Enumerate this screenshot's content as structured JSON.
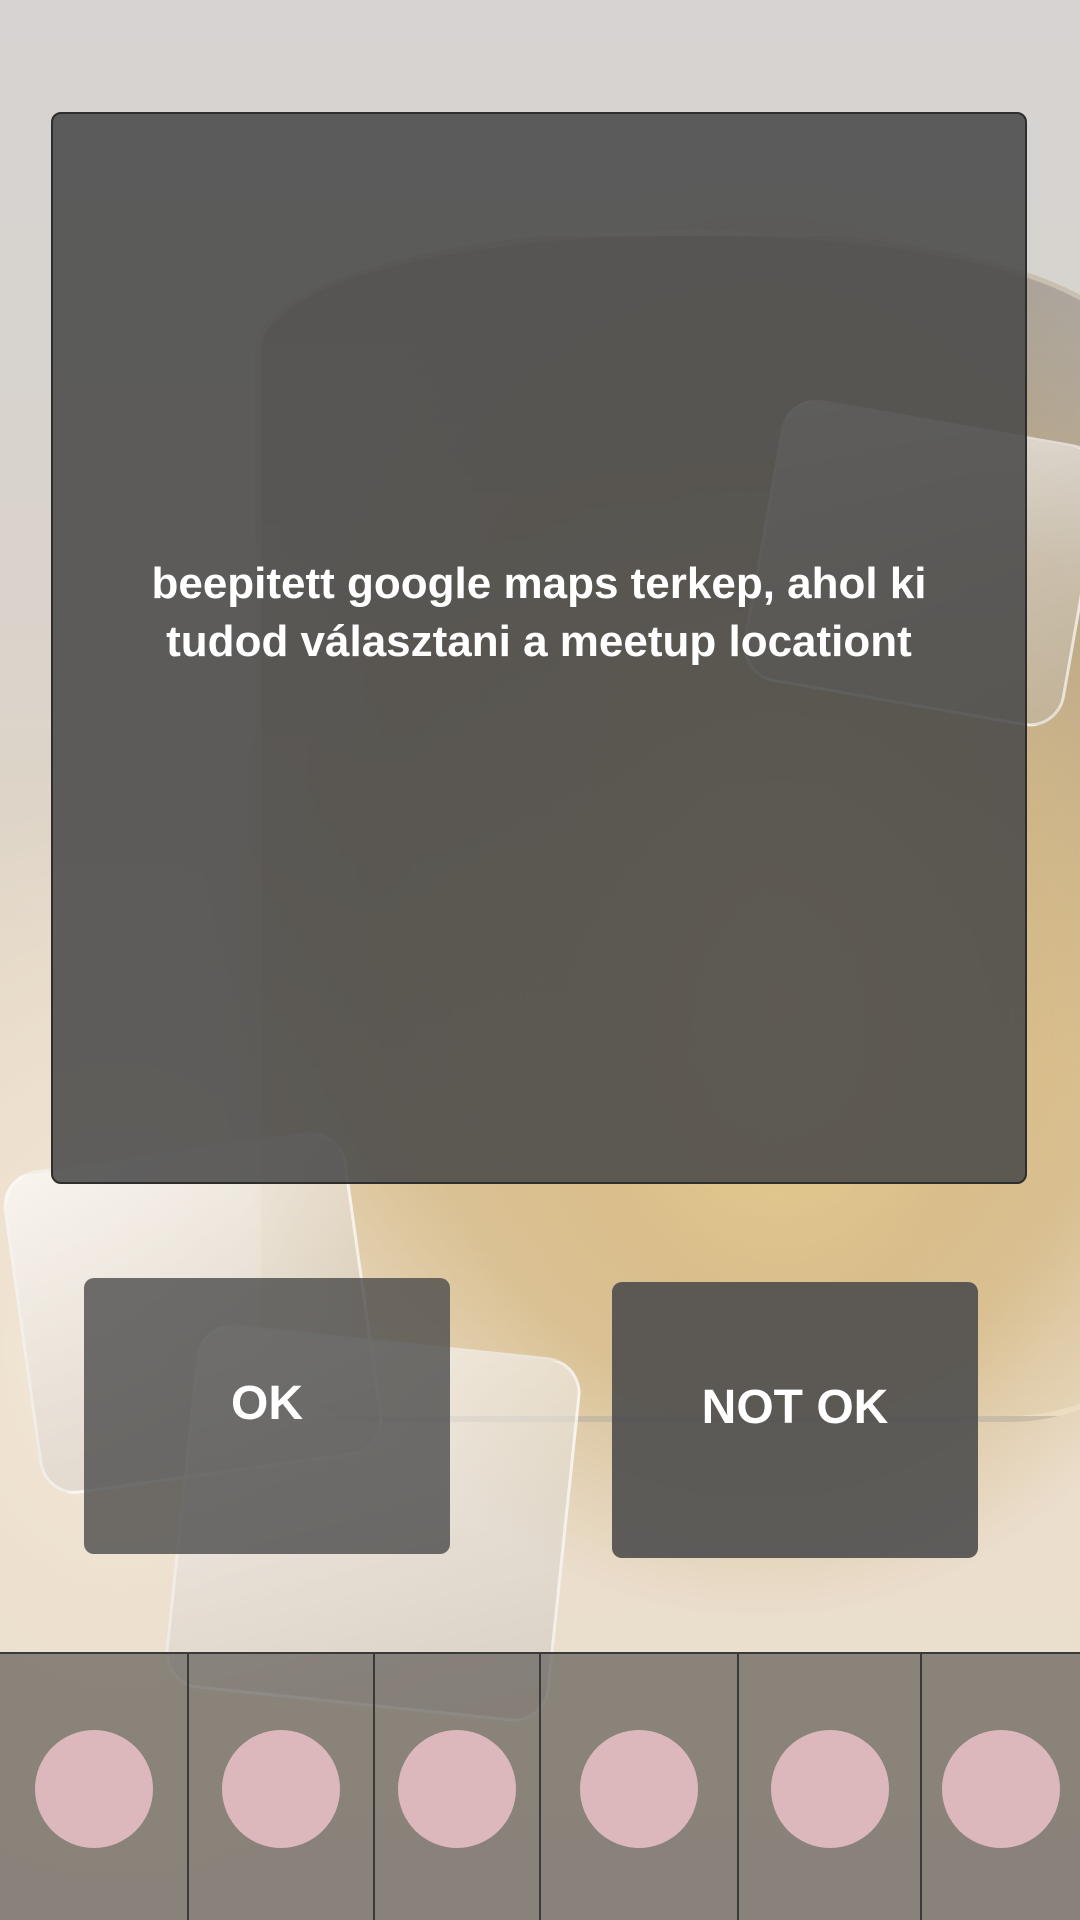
{
  "dialog": {
    "message_line1": "beepitett google maps terkep, ahol ki",
    "message_line2": "tudod választani a meetup locationt"
  },
  "actions": {
    "ok_label": "OK",
    "not_ok_label": "NOT OK"
  },
  "tabbar": {
    "tab_count": 6,
    "dot_color": "#dcb8bc"
  },
  "colors": {
    "card_background": "#4a4a4a",
    "button_background": "#484848",
    "text": "#ffffff"
  }
}
